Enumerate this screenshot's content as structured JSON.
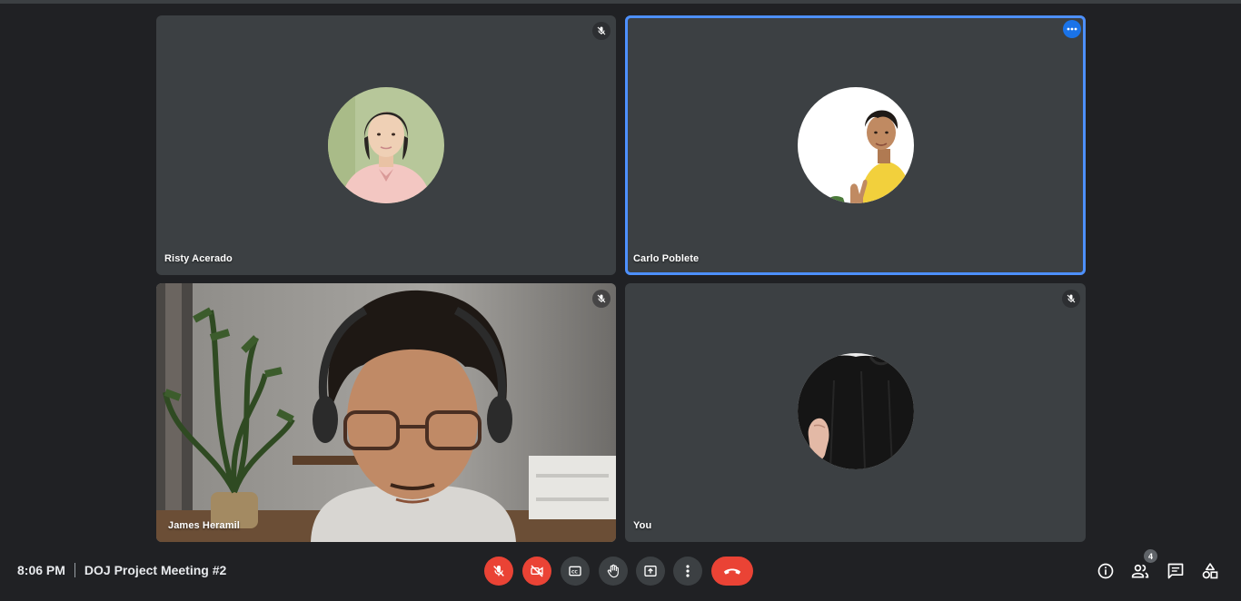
{
  "meeting": {
    "time": "8:06 PM",
    "title": "DOJ Project Meeting #2"
  },
  "participants": [
    {
      "name": "Risty Acerado",
      "muted": true
    },
    {
      "name": "Carlo Poblete",
      "active_speaker": true
    },
    {
      "name": "James Heramil",
      "muted": true,
      "video_on": true
    },
    {
      "name": "You",
      "muted": true
    }
  ],
  "controls": {
    "people_count": "4",
    "icons": [
      "mic-off-icon",
      "camera-off-icon",
      "captions-icon",
      "raise-hand-icon",
      "present-icon",
      "more-options-icon",
      "hang-up-icon",
      "info-icon",
      "people-icon",
      "chat-icon",
      "activities-icon"
    ]
  },
  "colors": {
    "background": "#202124",
    "tile": "#3c4043",
    "active_outline": "#4d90fe",
    "danger": "#ea4335",
    "accent": "#1a73e8"
  }
}
